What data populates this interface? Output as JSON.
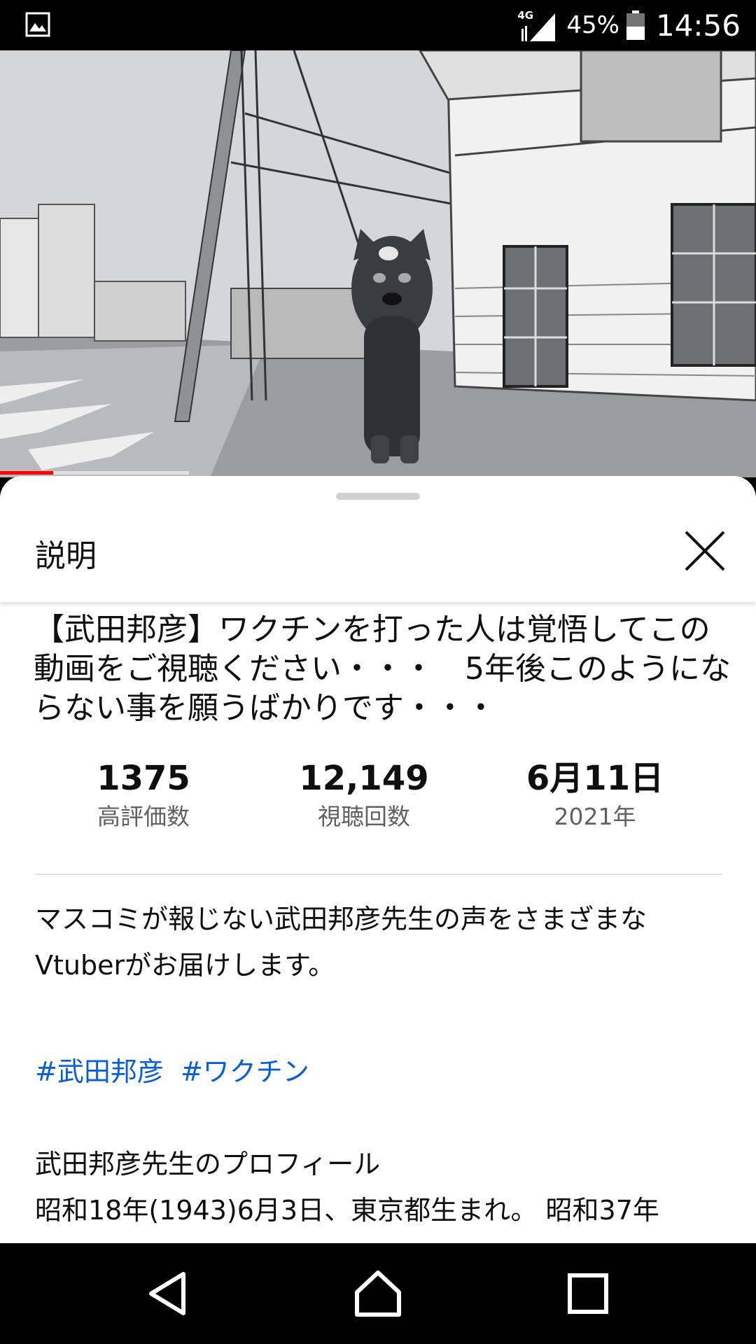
{
  "status_bar": {
    "network": "4G",
    "battery": "45%",
    "time": "14:56"
  },
  "video": {
    "progress_fraction": 0.07,
    "buffered_fraction": 0.25
  },
  "sheet": {
    "title": "説明",
    "video_title": "【武田邦彦】ワクチンを打った人は覚悟してこの動画をご視聴ください・・・　5年後このようにならない事を願うばかりです・・・",
    "stats": {
      "likes_value": "1375",
      "likes_label": "高評価数",
      "views_value": "12,149",
      "views_label": "視聴回数",
      "date_value": "6月11日",
      "date_label": "2021年"
    },
    "description_line1": "マスコミが報じない武田邦彦先生の声をさまざまな",
    "description_line2": "Vtuberがお届けします。",
    "hashtags": [
      "#武田邦彦",
      "#ワクチン"
    ],
    "profile_heading": "武田邦彦先生のプロフィール",
    "profile_text": "昭和18年(1943)6月3日、東京都生まれ。 昭和37年"
  },
  "colors": {
    "link": "#065fd4",
    "progress": "#ff0000",
    "secondary_text": "#606060"
  },
  "icons": {
    "close": "close-icon",
    "back": "back-triangle-icon",
    "home": "home-icon",
    "recent": "recent-apps-icon"
  }
}
